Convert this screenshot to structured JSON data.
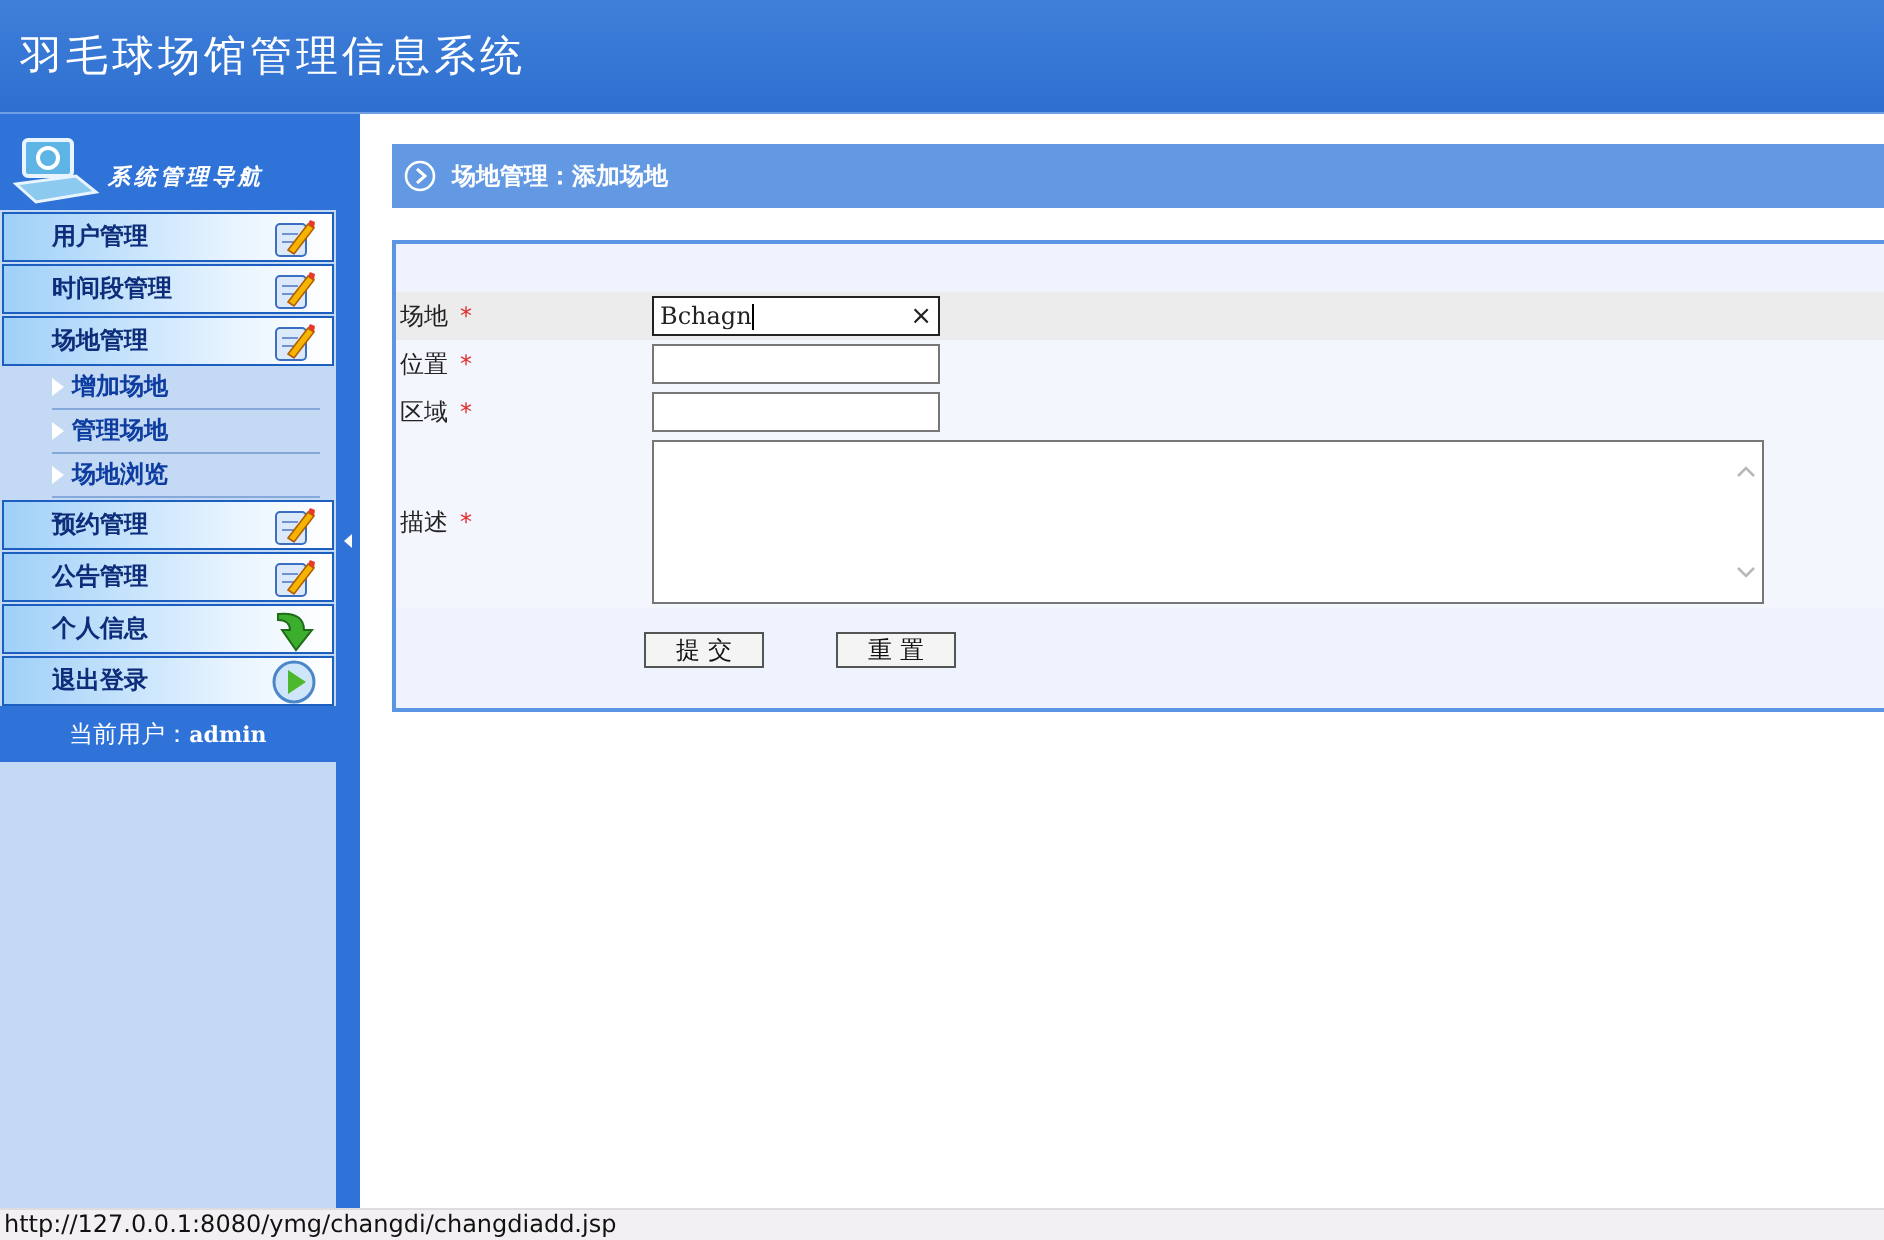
{
  "header": {
    "title": "羽毛球场馆管理信息系统"
  },
  "sidebar": {
    "title": "系统管理导航",
    "menu": [
      {
        "label": "用户管理",
        "kind": "edit"
      },
      {
        "label": "时间段管理",
        "kind": "edit"
      },
      {
        "label": "场地管理",
        "kind": "edit",
        "children": [
          {
            "label": "增加场地"
          },
          {
            "label": "管理场地"
          },
          {
            "label": "场地浏览"
          }
        ]
      },
      {
        "label": "预约管理",
        "kind": "edit"
      },
      {
        "label": "公告管理",
        "kind": "edit"
      },
      {
        "label": "个人信息",
        "kind": "arrow"
      },
      {
        "label": "退出登录",
        "kind": "play"
      }
    ],
    "current_user": {
      "label": "当前用户：",
      "name": "admin"
    }
  },
  "breadcrumb": "场地管理：添加场地",
  "form": {
    "fields": [
      {
        "label": "场地",
        "required": "*",
        "kind": "input",
        "value": "Bchagn",
        "focused": true,
        "highlighted": true,
        "clear": "×"
      },
      {
        "label": "位置",
        "required": "*",
        "kind": "input",
        "focused": false,
        "highlighted": false
      },
      {
        "label": "区域",
        "required": "*",
        "kind": "input",
        "focused": false,
        "highlighted": false
      },
      {
        "label": "描述",
        "required": "*",
        "kind": "textarea",
        "focused": false,
        "highlighted": false
      }
    ],
    "buttons": [
      "提 交",
      "重 置"
    ]
  },
  "status_bar": "http://127.0.0.1:8080/ymg/changdi/changdiadd.jsp"
}
